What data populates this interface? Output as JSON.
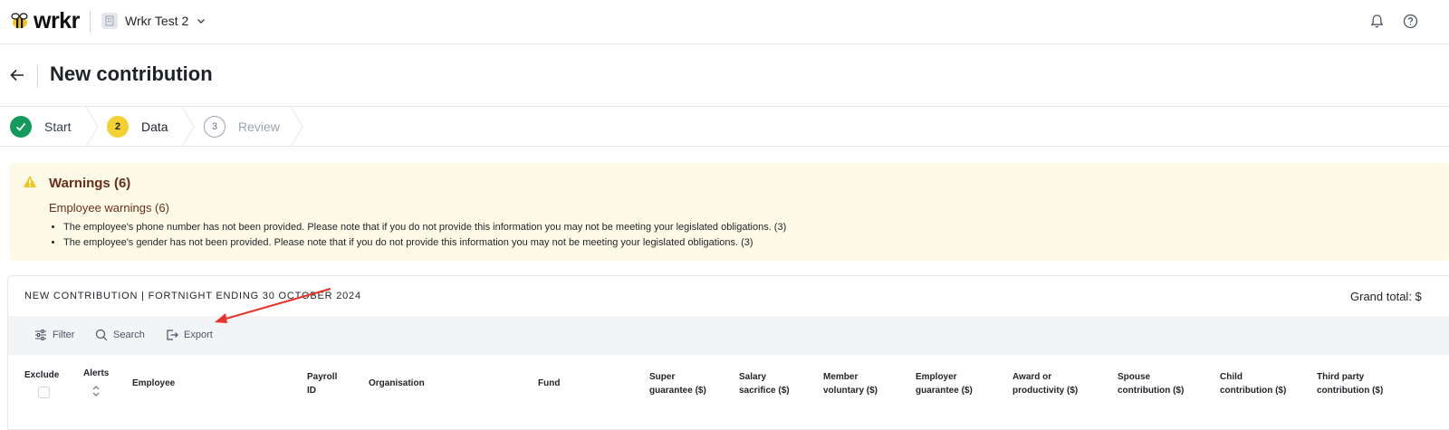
{
  "app": {
    "logo_text": "wrkr",
    "org_name": "Wrkr Test 2"
  },
  "header": {
    "title": "New contribution"
  },
  "steps": [
    {
      "number": "",
      "label": "Start",
      "state": "done"
    },
    {
      "number": "2",
      "label": "Data",
      "state": "current"
    },
    {
      "number": "3",
      "label": "Review",
      "state": "todo"
    }
  ],
  "warnings": {
    "title": "Warnings (6)",
    "subtitle": "Employee warnings (6)",
    "items": [
      "The employee's phone number has not been provided. Please note that if you do not provide this information you may not be meeting your legislated obligations. (3)",
      "The employee's gender has not been provided. Please note that if you do not provide this information you may not be meeting your legislated obligations. (3)"
    ]
  },
  "card": {
    "title": "NEW CONTRIBUTION | FORTNIGHT ENDING 30 OCTOBER 2024",
    "grand_total": "Grand total: $"
  },
  "toolbar": {
    "filter": "Filter",
    "search": "Search",
    "export": "Export"
  },
  "table": {
    "headers": {
      "exclude": "Exclude",
      "alerts": "Alerts",
      "employee": "Employee",
      "payroll_1": "Payroll",
      "payroll_2": "ID",
      "organisation": "Organisation",
      "fund": "Fund",
      "super_1": "Super",
      "super_2": "guarantee ($)",
      "salary_1": "Salary",
      "salary_2": "sacrifice ($)",
      "member_1": "Member",
      "member_2": "voluntary ($)",
      "employer_1": "Employer",
      "employer_2": "guarantee ($)",
      "award_1": "Award or",
      "award_2": "productivity ($)",
      "spouse_1": "Spouse",
      "spouse_2": "contribution ($)",
      "child_1": "Child",
      "child_2": "contribution ($)",
      "third_1": "Third party",
      "third_2": "contribution ($)"
    }
  },
  "colors": {
    "success": "#159a5e",
    "current_step": "#f2d130",
    "warning_bg": "#fdfbe7",
    "warning_text": "#6b2d1a",
    "annotation_arrow": "#e8322b"
  }
}
